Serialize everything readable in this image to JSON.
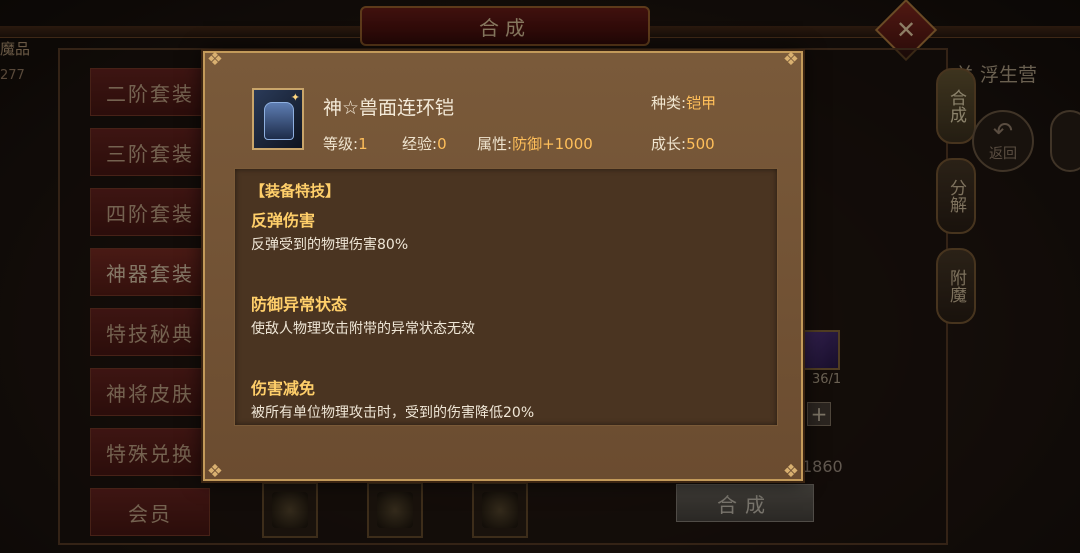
{
  "background": {
    "title": "合成",
    "left_top_text": "魔品",
    "left_top_number": "277",
    "level_text": "关 浮生营",
    "side_menu": [
      "二阶套装",
      "三阶套装",
      "四阶套装",
      "神器套装",
      "特技秘典",
      "神将皮肤",
      "特殊兑换",
      "会员"
    ],
    "right_tabs": [
      "合成",
      "分解",
      "附魔"
    ],
    "back_label": "返回",
    "gem_count": "36/1",
    "coin_value": "1860",
    "compose_button": "合成"
  },
  "popup": {
    "item_name": "神☆兽面连环铠",
    "kind_label": "种类:",
    "kind_value": "铠甲",
    "level_label": "等级:",
    "level_value": "1",
    "exp_label": "经验:",
    "exp_value": "0",
    "attr_label": "属性:",
    "attr_value": "防御+1000",
    "growth_label": "成长:",
    "growth_value": "500",
    "skills_header": "【装备特技】",
    "skills": [
      {
        "name": "反弹伤害",
        "desc": "反弹受到的物理伤害80%"
      },
      {
        "name": "防御异常状态",
        "desc": "使敌人物理攻击附带的异常状态无效"
      },
      {
        "name": "伤害减免",
        "desc": "被所有单位物理攻击时，受到的伤害降低20%"
      }
    ]
  },
  "colors": {
    "popup_bg": "#6b4c30",
    "highlight": "#ffbf5a",
    "skill_title": "#ffcf6a",
    "side_button": "#6b2520"
  },
  "icons": {
    "item": "armor-icon",
    "close": "close-icon",
    "back": "back-arrow-icon",
    "plus": "plus-icon",
    "gem": "gem-icon"
  }
}
